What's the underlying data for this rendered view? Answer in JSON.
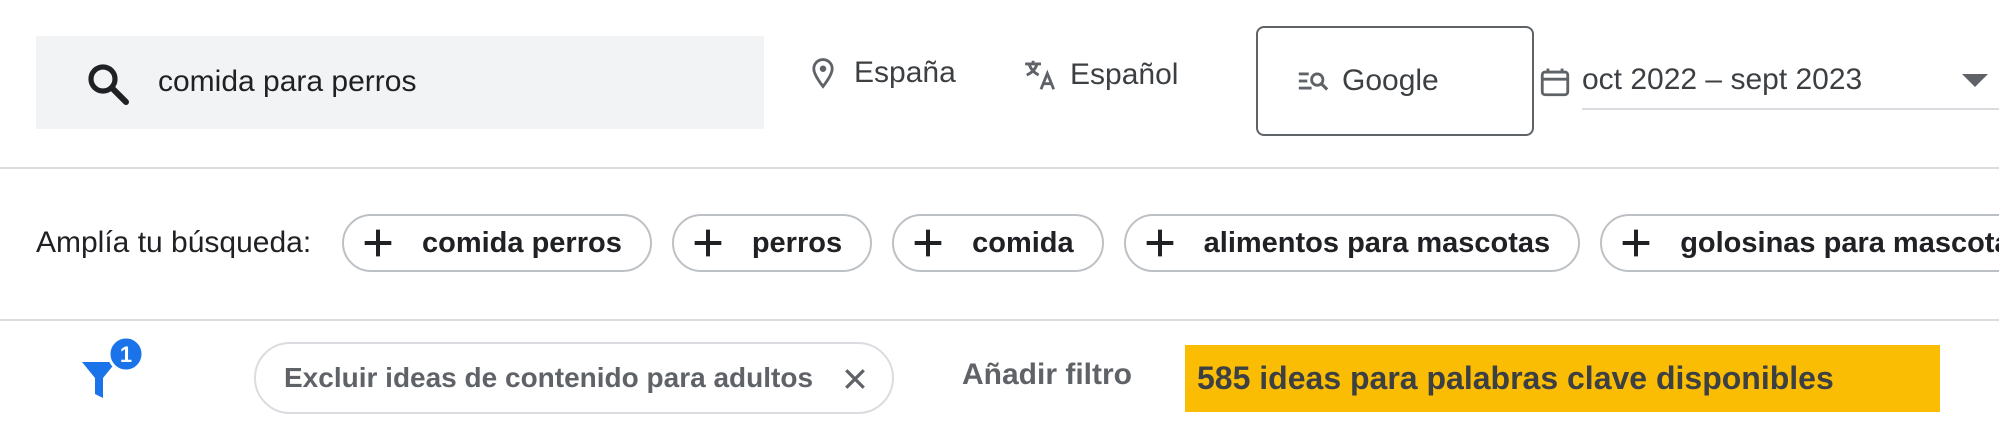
{
  "search": {
    "value": "comida para perros",
    "icon": "search-icon"
  },
  "filters_bar": {
    "location": {
      "label": "España",
      "icon": "location-pin-icon"
    },
    "language": {
      "label": "Español",
      "icon": "translate-icon"
    },
    "engine": {
      "label": "Google",
      "icon": "search-engine-icon"
    },
    "date_range": {
      "label": "oct 2022 – sept 2023",
      "icon": "calendar-icon"
    }
  },
  "broaden": {
    "label": "Amplía tu búsqueda:",
    "chips": [
      {
        "label": "comida perros"
      },
      {
        "label": "perros"
      },
      {
        "label": "comida"
      },
      {
        "label": "alimentos para mascotas"
      },
      {
        "label": "golosinas para mascotas"
      }
    ]
  },
  "filters": {
    "active_count": "1",
    "exclude_chip": "Excluir ideas de contenido para adultos",
    "add_filter": "Añadir filtro",
    "ideas_count_text": "585 ideas para palabras clave disponibles"
  },
  "colors": {
    "accent_blue": "#1a73e8",
    "highlight_yellow": "#fbbc04",
    "search_bg": "#f1f3f4"
  }
}
